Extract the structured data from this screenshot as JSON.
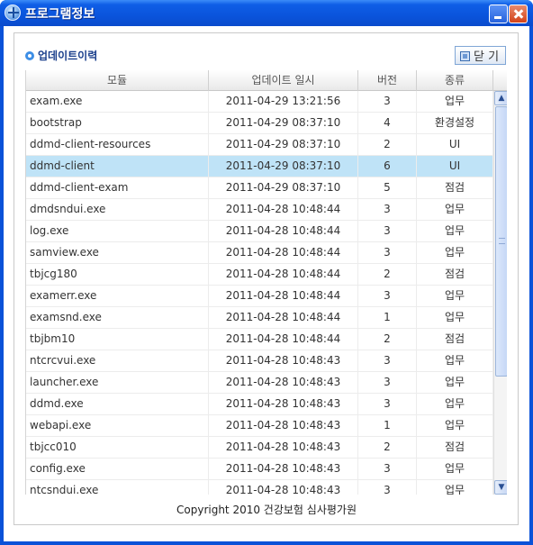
{
  "window": {
    "title": "프로그램정보"
  },
  "section": {
    "title": "업데이트이력"
  },
  "close_button": {
    "label": "닫 기"
  },
  "grid": {
    "columns": [
      "모듈",
      "업데이트 일시",
      "버전",
      "종류"
    ],
    "rows": [
      [
        "exam.exe",
        "2011-04-29 13:21:56",
        "3",
        "업무"
      ],
      [
        "bootstrap",
        "2011-04-29 08:37:10",
        "4",
        "환경설정"
      ],
      [
        "ddmd-client-resources",
        "2011-04-29 08:37:10",
        "2",
        "UI"
      ],
      [
        "ddmd-client",
        "2011-04-29 08:37:10",
        "6",
        "UI"
      ],
      [
        "ddmd-client-exam",
        "2011-04-29 08:37:10",
        "5",
        "점검"
      ],
      [
        "dmdsndui.exe",
        "2011-04-28 10:48:44",
        "3",
        "업무"
      ],
      [
        "log.exe",
        "2011-04-28 10:48:44",
        "3",
        "업무"
      ],
      [
        "samview.exe",
        "2011-04-28 10:48:44",
        "3",
        "업무"
      ],
      [
        "tbjcg180",
        "2011-04-28 10:48:44",
        "2",
        "점검"
      ],
      [
        "examerr.exe",
        "2011-04-28 10:48:44",
        "3",
        "업무"
      ],
      [
        "examsnd.exe",
        "2011-04-28 10:48:44",
        "1",
        "업무"
      ],
      [
        "tbjbm10",
        "2011-04-28 10:48:44",
        "2",
        "점검"
      ],
      [
        "ntcrcvui.exe",
        "2011-04-28 10:48:43",
        "3",
        "업무"
      ],
      [
        "launcher.exe",
        "2011-04-28 10:48:43",
        "3",
        "업무"
      ],
      [
        "ddmd.exe",
        "2011-04-28 10:48:43",
        "3",
        "업무"
      ],
      [
        "webapi.exe",
        "2011-04-28 10:48:43",
        "1",
        "업무"
      ],
      [
        "tbjcc010",
        "2011-04-28 10:48:43",
        "2",
        "점검"
      ],
      [
        "config.exe",
        "2011-04-28 10:48:43",
        "3",
        "업무"
      ],
      [
        "ntcsndui.exe",
        "2011-04-28 10:48:43",
        "3",
        "업무"
      ]
    ],
    "selected_row": 3
  },
  "footer": {
    "copyright": "Copyright 2010 건강보험 심사평가원"
  },
  "colors": {
    "titlebar": "#0a54dc",
    "selected_row": "#bfe3f7",
    "section_title": "#1a3f8c"
  }
}
